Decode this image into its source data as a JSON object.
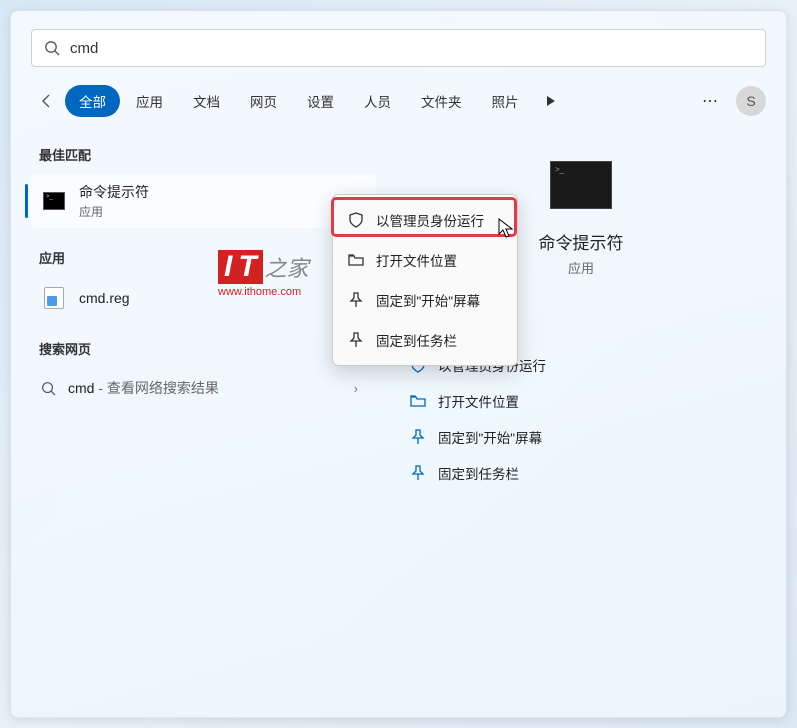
{
  "search": {
    "value": "cmd"
  },
  "tabs": [
    "全部",
    "应用",
    "文档",
    "网页",
    "设置",
    "人员",
    "文件夹",
    "照片"
  ],
  "avatar_letter": "S",
  "sections": {
    "best_match": "最佳匹配",
    "apps": "应用",
    "search_web": "搜索网页"
  },
  "best_match_result": {
    "title": "命令提示符",
    "subtitle": "应用"
  },
  "app_result": {
    "title": "cmd.reg"
  },
  "web_result": {
    "prefix": "cmd",
    "suffix": " - 查看网络搜索结果"
  },
  "preview": {
    "title": "命令提示符",
    "subtitle": "应用"
  },
  "context_menu": {
    "run_admin": "以管理员身份运行",
    "open_location": "打开文件位置",
    "pin_start": "固定到\"开始\"屏幕",
    "pin_taskbar": "固定到任务栏"
  },
  "actions": {
    "run_admin": "以管理员身份运行",
    "open_location": "打开文件位置",
    "pin_start": "固定到\"开始\"屏幕",
    "pin_taskbar": "固定到任务栏"
  },
  "watermark": {
    "logo_it": "IT",
    "logo_suffix": "之家",
    "url": "www.ithome.com"
  }
}
